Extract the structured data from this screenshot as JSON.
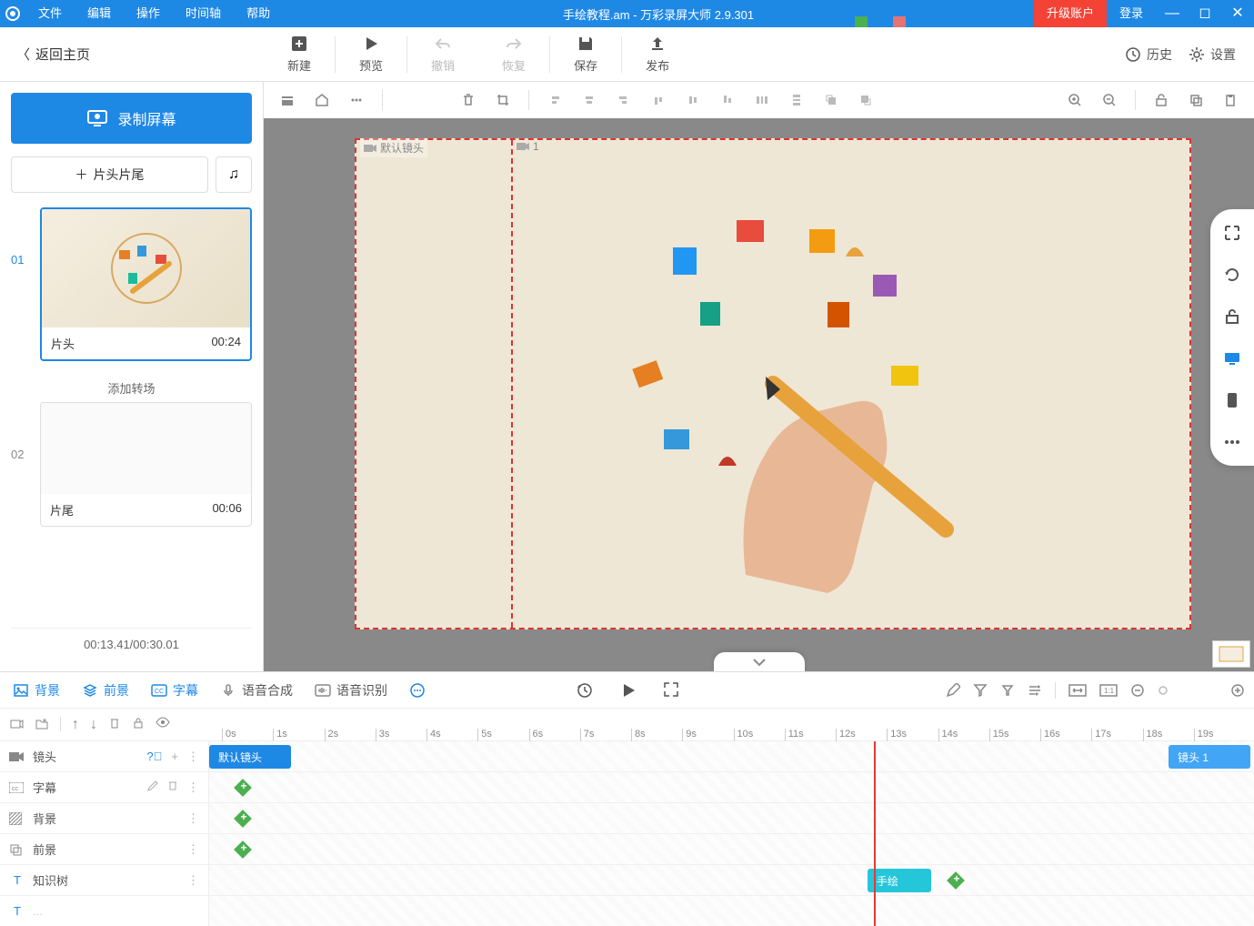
{
  "titlebar": {
    "menus": [
      "文件",
      "编辑",
      "操作",
      "时间轴",
      "帮助"
    ],
    "title": "手绘教程.am - 万彩录屏大师 2.9.301",
    "upgrade": "升级账户",
    "login": "登录"
  },
  "toolbar": {
    "back": "返回主页",
    "new": "新建",
    "preview": "预览",
    "undo": "撤销",
    "redo": "恢复",
    "save": "保存",
    "publish": "发布",
    "history": "历史",
    "settings": "设置"
  },
  "sidebar": {
    "record": "录制屏幕",
    "intro": "片头片尾",
    "scenes": [
      {
        "num": "01",
        "name": "片头",
        "time": "00:24"
      },
      {
        "num": "02",
        "name": "片尾",
        "time": "00:06"
      }
    ],
    "transition": "添加转场",
    "timer": "00:13.41/00:30.01"
  },
  "canvas": {
    "frame_label": "默认镜头",
    "marker2": "1"
  },
  "timeline_tabs": {
    "bg": "背景",
    "fg": "前景",
    "subtitle": "字幕",
    "tts": "语音合成",
    "asr": "语音识别"
  },
  "ruler": [
    "0s",
    "1s",
    "2s",
    "3s",
    "4s",
    "5s",
    "6s",
    "7s",
    "8s",
    "9s",
    "10s",
    "11s",
    "12s",
    "13s",
    "14s",
    "15s",
    "16s",
    "17s",
    "18s",
    "19s"
  ],
  "tracks": {
    "camera": "镜头",
    "subtitle": "字幕",
    "bg": "背景",
    "fg": "前景",
    "tree": "知识树",
    "clip_default": "默认镜头",
    "clip_cam1": "镜头 1",
    "clip_draw": "手绘"
  }
}
